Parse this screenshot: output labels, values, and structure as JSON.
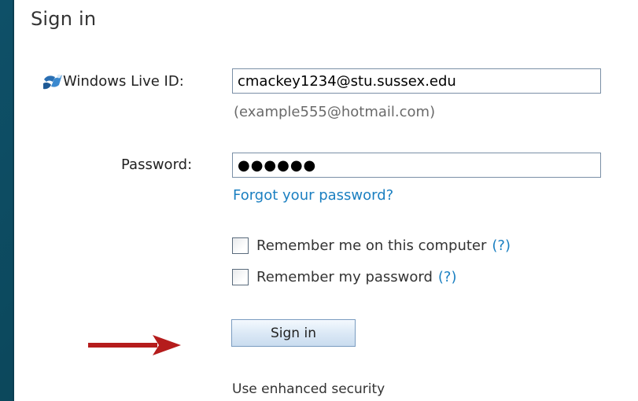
{
  "page": {
    "title": "Sign in"
  },
  "form": {
    "live_id_label": "Windows Live ID:",
    "live_id_value": "cmackey1234@stu.sussex.edu",
    "live_id_hint": "(example555@hotmail.com)",
    "password_label": "Password:",
    "password_value": "●●●●●●",
    "forgot_link": "Forgot your password?",
    "remember_computer_label": "Remember me on this computer",
    "remember_password_label": "Remember my password",
    "help_link": "(?)",
    "remember_computer_checked": false,
    "remember_password_checked": false,
    "signin_button": "Sign in",
    "enhanced_security": "Use enhanced security"
  },
  "icons": {
    "live_id_icon": "windows-live-icon",
    "annotation_arrow": "red-arrow-icon"
  },
  "colors": {
    "background": "#0f4f63",
    "link": "#1a7fc1",
    "arrow": "#b51c1c",
    "button_gradient_top": "#f4f9fe",
    "button_gradient_bottom": "#c9dcef"
  }
}
